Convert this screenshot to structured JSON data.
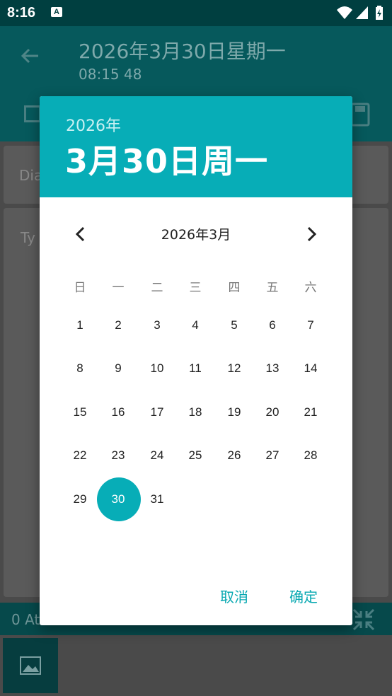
{
  "status_bar": {
    "time": "8:16",
    "ime_label": "A"
  },
  "app_bar": {
    "title": "2026年3月30日星期一",
    "subtitle": "08:15 48"
  },
  "background": {
    "field1": "Dia",
    "field2": "Ty",
    "attachments": "0 At"
  },
  "dialog": {
    "header_year": "2026年",
    "header_date": "3月30日周一",
    "month_label": "2026年3月",
    "weekdays": [
      "日",
      "一",
      "二",
      "三",
      "四",
      "五",
      "六"
    ],
    "days": [
      "1",
      "2",
      "3",
      "4",
      "5",
      "6",
      "7",
      "8",
      "9",
      "10",
      "11",
      "12",
      "13",
      "14",
      "15",
      "16",
      "17",
      "18",
      "19",
      "20",
      "21",
      "22",
      "23",
      "24",
      "25",
      "26",
      "27",
      "28",
      "29",
      "30",
      "31"
    ],
    "selected_day": "30",
    "cancel_label": "取消",
    "ok_label": "确定",
    "accent_color": "#07adb7"
  }
}
